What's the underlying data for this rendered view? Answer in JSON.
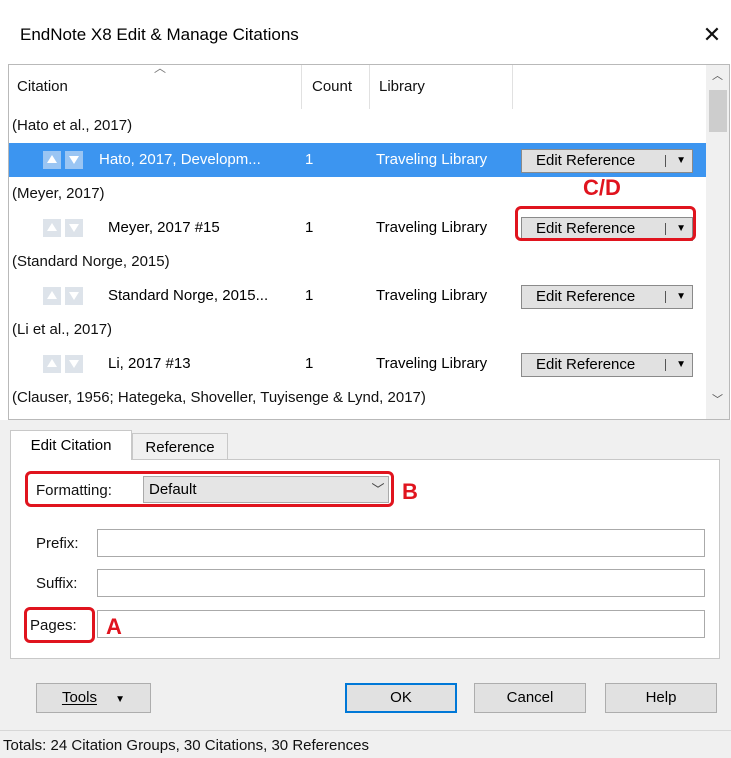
{
  "window": {
    "title": "EndNote X8 Edit & Manage Citations",
    "close_glyph": "✕"
  },
  "grid": {
    "headers": {
      "citation": "Citation",
      "count": "Count",
      "library": "Library"
    },
    "groups": [
      {
        "label": "(Hato et al., 2017)",
        "item": {
          "citation": "Hato, 2017, Developm...",
          "count": "1",
          "library": "Traveling Library",
          "action": "Edit Reference"
        }
      },
      {
        "label": "(Meyer, 2017)",
        "item": {
          "citation": "Meyer, 2017 #15",
          "count": "1",
          "library": "Traveling Library",
          "action": "Edit Reference"
        }
      },
      {
        "label": "(Standard Norge, 2015)",
        "item": {
          "citation": "Standard Norge, 2015...",
          "count": "1",
          "library": "Traveling Library",
          "action": "Edit Reference"
        }
      },
      {
        "label": "(Li et al., 2017)",
        "item": {
          "citation": "Li, 2017 #13",
          "count": "1",
          "library": "Traveling Library",
          "action": "Edit Reference"
        }
      },
      {
        "label": "(Clauser, 1956; Hategeka, Shoveller, Tuyisenge & Lynd, 2017)"
      }
    ]
  },
  "tabs": {
    "edit_citation": "Edit Citation",
    "reference": "Reference"
  },
  "form": {
    "formatting_label": "Formatting:",
    "formatting_value": "Default",
    "prefix_label": "Prefix:",
    "suffix_label": "Suffix:",
    "pages_label": "Pages:"
  },
  "annotations": {
    "a": "A",
    "b": "B",
    "cd": "C/D",
    "color": "#e0141e"
  },
  "buttons": {
    "tools": "Tools",
    "ok": "OK",
    "cancel": "Cancel",
    "help": "Help"
  },
  "status": "Totals: 24 Citation Groups, 30 Citations, 30 References",
  "colors": {
    "selection": "#3c95f0",
    "accent": "#0078d7"
  }
}
